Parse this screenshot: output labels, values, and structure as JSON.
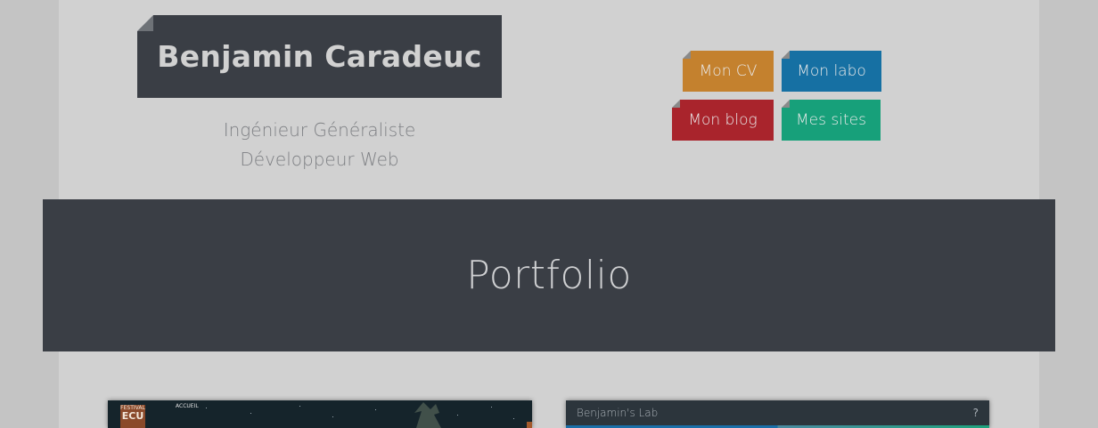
{
  "header": {
    "site_title": "Benjamin Caradeuc",
    "tagline_line1": "Ingénieur Généraliste",
    "tagline_line2": "Développeur Web"
  },
  "nav": {
    "cv": "Mon CV",
    "labo": "Mon labo",
    "blog": "Mon blog",
    "sites": "Mes sites"
  },
  "section": {
    "title": "Portfolio"
  },
  "portfolio": {
    "card1": {
      "logo_top": "FESTIVAL",
      "logo_main": "ECU",
      "menu_item": "ACCUEIL"
    },
    "card2": {
      "title": "Benjamin's Lab",
      "help": "?"
    }
  },
  "colors": {
    "cv": "#c4812e",
    "labo": "#1670a3",
    "blog": "#a9242c",
    "sites": "#17a07a",
    "dark": "#3a3e45"
  }
}
